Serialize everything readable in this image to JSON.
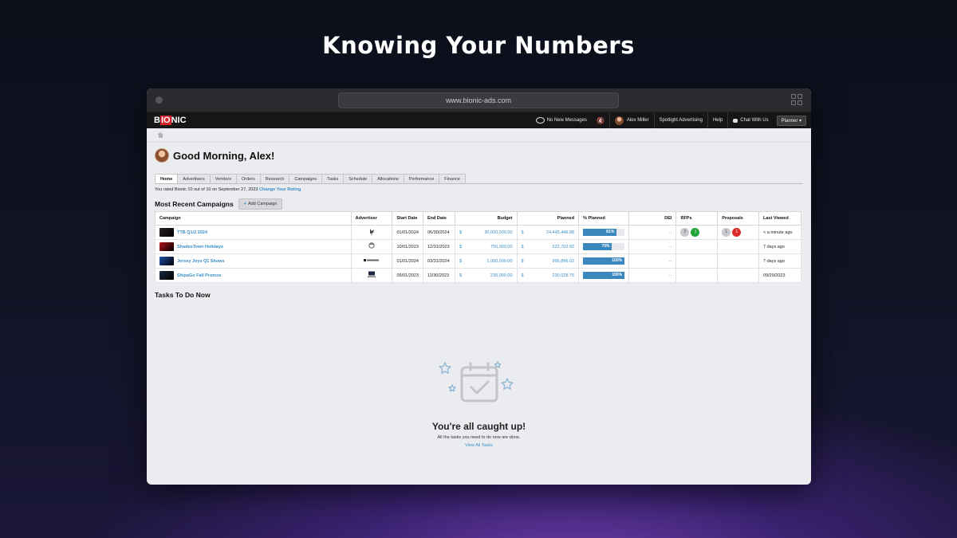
{
  "headline": "Knowing Your Numbers",
  "browser": {
    "url": "www.bionic-ads.com"
  },
  "nav": {
    "logo_prefix": "B",
    "logo_highlight": "IO",
    "logo_suffix": "NIC",
    "messages": "No New Messages",
    "user": "Alex Miller",
    "company": "Spotlight Advertising",
    "help": "Help",
    "chat": "Chat With Us",
    "planner": "Planner ▾"
  },
  "greeting": "Good Morning, Alex!",
  "tabs": [
    "Home",
    "Advertisers",
    "Vendors",
    "Orders",
    "Research",
    "Campaigns",
    "Tasks",
    "Schedule",
    "Allocations",
    "Performance",
    "Finance"
  ],
  "rating": {
    "text": "You rated Bionic 10 out of 10 on September 27, 2023",
    "link": "Change Your Rating"
  },
  "campaigns": {
    "title": "Most Recent Campaigns",
    "add_button": "Add Campaign",
    "columns": [
      "Campaign",
      "Advertiser",
      "Start Date",
      "End Date",
      "Budget",
      "Planned",
      "% Planned",
      "DEI",
      "RFPs",
      "Proposals",
      "Last Viewed"
    ],
    "rows": [
      {
        "name": "TTB Q1/2 2024",
        "advertiser_logo": "spotlight-logo",
        "start": "01/01/2024",
        "end": "06/30/2024",
        "budget": "30,000,000.00",
        "planned": "24,445,446.88",
        "pct": 81,
        "pct_label": "81%",
        "dei": "--",
        "rfps": [
          "2",
          "1"
        ],
        "proposals": [
          "1",
          "1"
        ],
        "last_viewed": "< a minute ago",
        "thumb_color": "#2a2020"
      },
      {
        "name": "ShadesTown Holidays",
        "advertiser_logo": "shadestown-logo",
        "start": "10/01/2023",
        "end": "12/31/2023",
        "budget": "750,000.00",
        "planned": "522,702.82",
        "pct": 70,
        "pct_label": "70%",
        "dei": "--",
        "rfps": [],
        "proposals": [],
        "last_viewed": "7 days ago",
        "thumb_color": "#b3151c"
      },
      {
        "name": "Jersey Joys Q1 Shows",
        "advertiser_logo": "jersey-joys-logo",
        "start": "01/01/2024",
        "end": "03/31/2024",
        "budget": "1,000,000.00",
        "planned": "995,896.62",
        "pct": 100,
        "pct_label": "100%",
        "dei": "--",
        "rfps": [],
        "proposals": [],
        "last_viewed": "7 days ago",
        "thumb_color": "#1e4fa8"
      },
      {
        "name": "ShipaGo Fall Promos",
        "advertiser_logo": "shipago-logo",
        "start": "09/01/2023",
        "end": "11/30/2023",
        "budget": "230,000.00",
        "planned": "230,028.75",
        "pct": 100,
        "pct_label": "100%",
        "dei": "--",
        "rfps": [],
        "proposals": [],
        "last_viewed": "09/29/2023",
        "thumb_color": "#1a2a40"
      }
    ],
    "currency": "$"
  },
  "tasks": {
    "title": "Tasks To Do Now",
    "empty_title": "You're all caught up!",
    "empty_sub": "All the tasks you need to do now are done.",
    "view_all": "View All Tasks"
  },
  "colors": {
    "accent": "#3a8fc9",
    "bar": "#3b88bf",
    "logo_red": "#d6222a",
    "green": "#22a33a",
    "red": "#de2b2b"
  }
}
